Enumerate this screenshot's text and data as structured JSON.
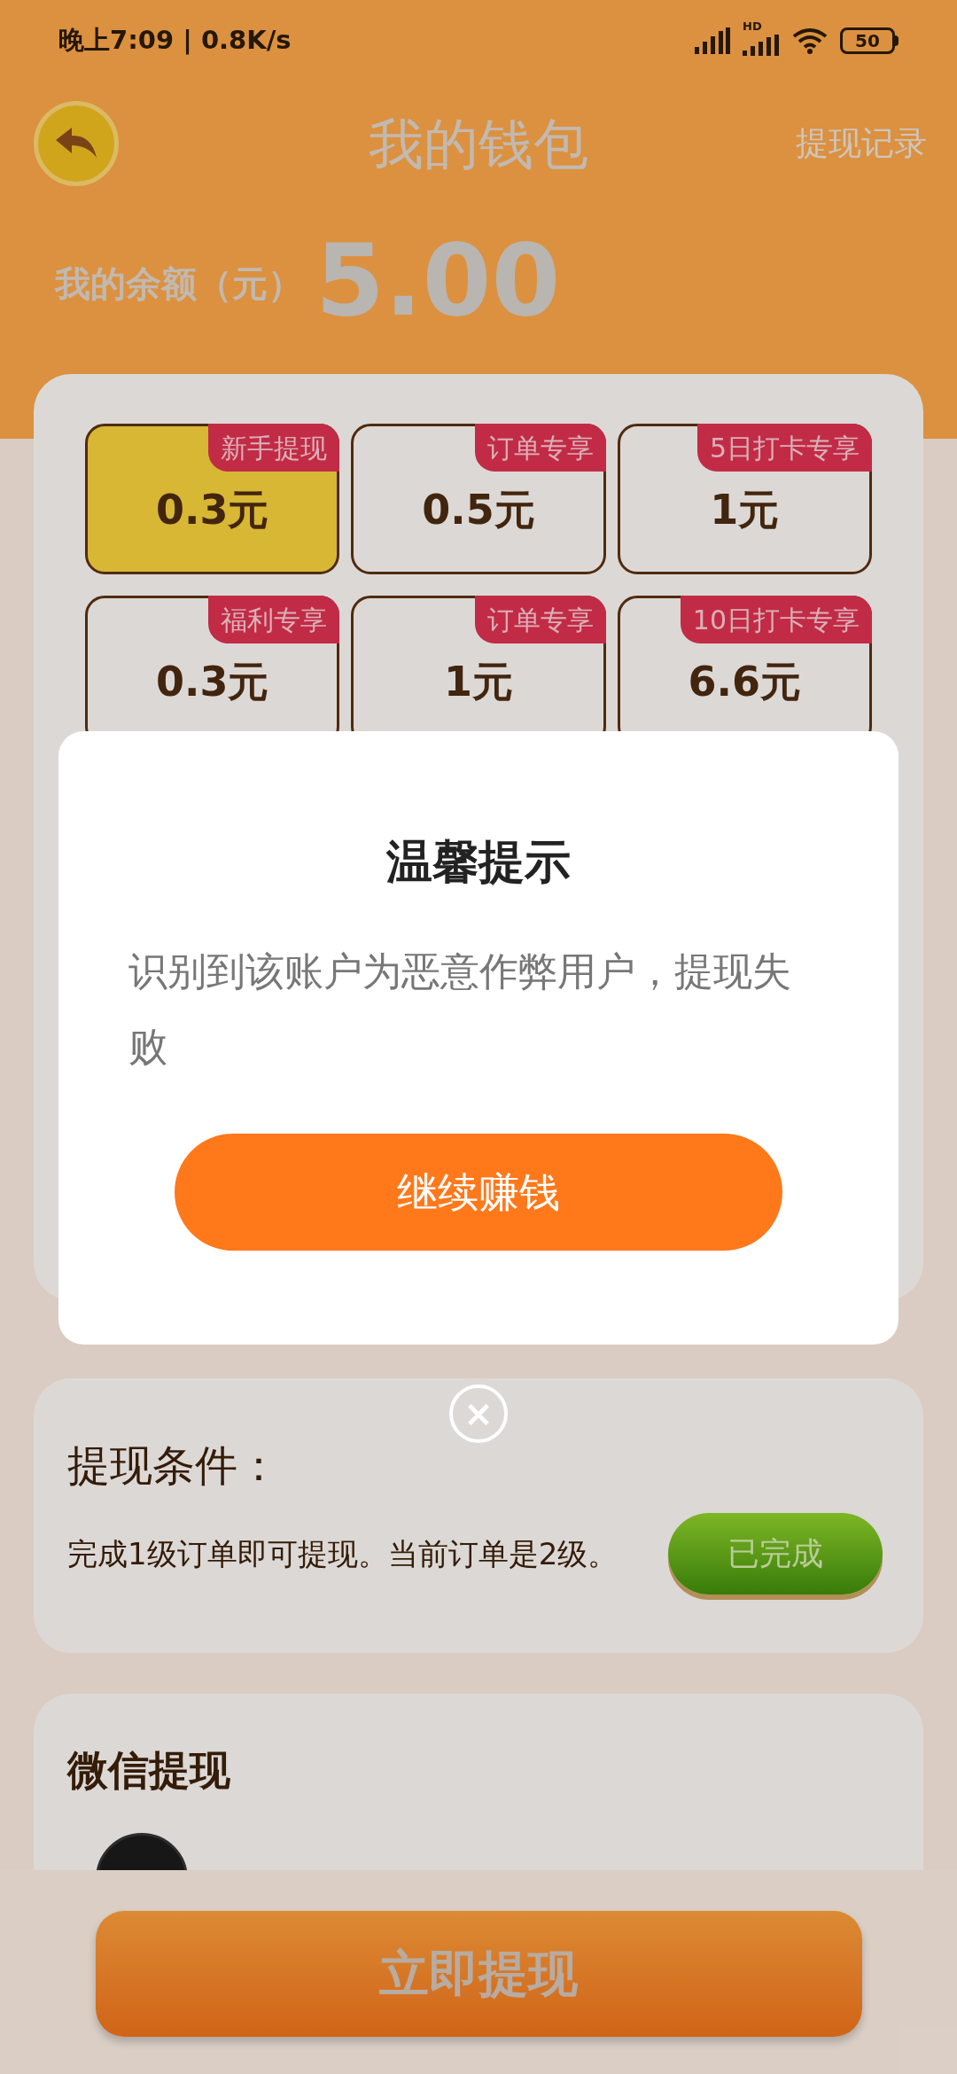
{
  "status_bar": {
    "time": "晚上7:09 | 0.8K/s",
    "network_label": "HD",
    "battery": "50"
  },
  "header": {
    "title": "我的钱包",
    "record_link": "提现记录"
  },
  "balance": {
    "label": "我的余额（元）",
    "amount": "5.00"
  },
  "options": [
    {
      "tag": "新手提现",
      "amount": "0.3元",
      "selected": true
    },
    {
      "tag": "订单专享",
      "amount": "0.5元",
      "selected": false
    },
    {
      "tag": "5日打卡专享",
      "amount": "1元",
      "selected": false
    },
    {
      "tag": "福利专享",
      "amount": "0.3元",
      "selected": false
    },
    {
      "tag": "订单专享",
      "amount": "1元",
      "selected": false
    },
    {
      "tag": "10日打卡专享",
      "amount": "6.6元",
      "selected": false
    }
  ],
  "dialog": {
    "title": "温馨提示",
    "message": "识别到该账户为恶意作弊用户，提现失败",
    "button": "继续赚钱",
    "close": "×"
  },
  "conditions": {
    "title": "提现条件：",
    "description": "完成1级订单即可提现。当前订单是2级。",
    "status_button": "已完成"
  },
  "wechat": {
    "title": "微信提现"
  },
  "withdraw_button": "立即提现"
}
